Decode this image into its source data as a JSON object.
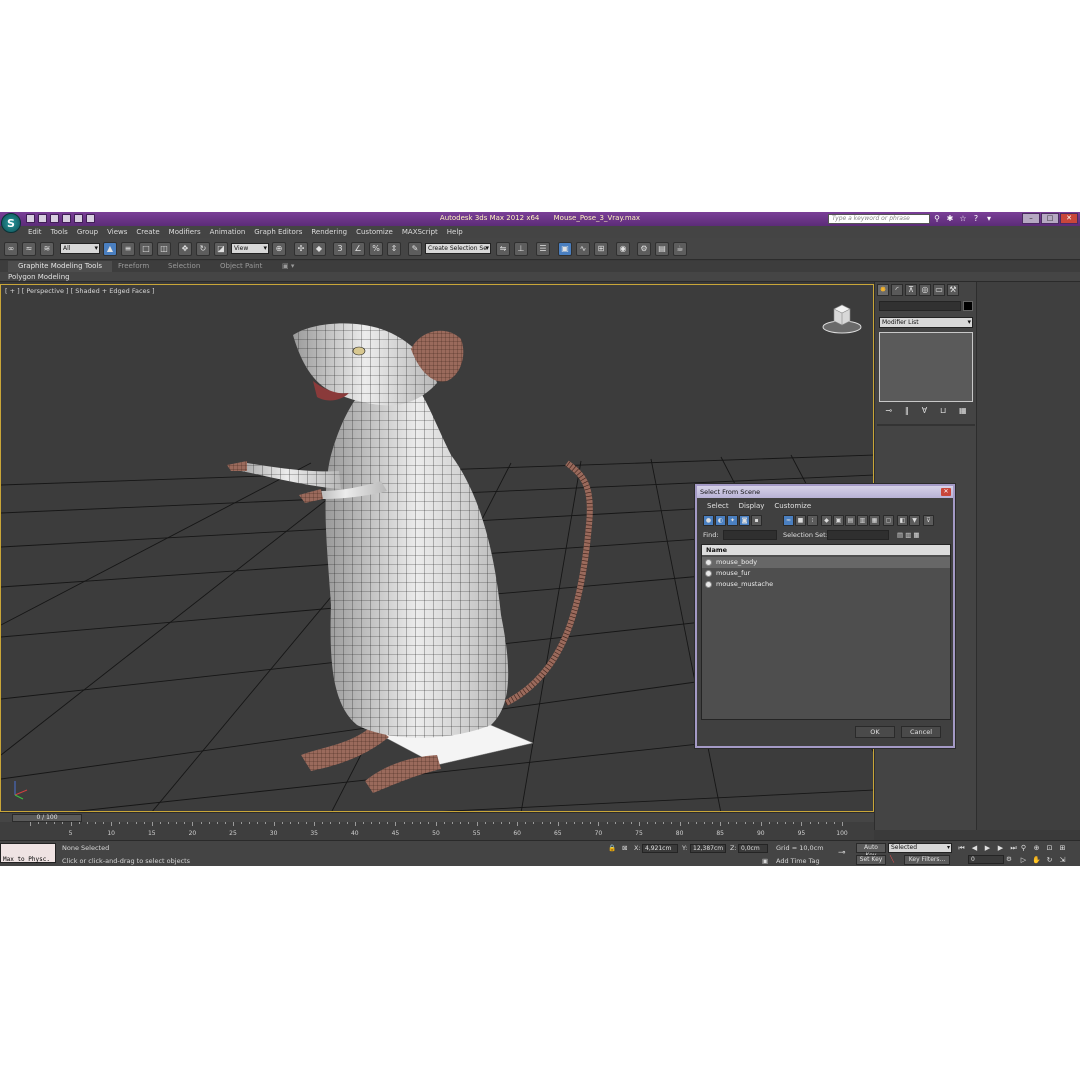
{
  "titlebar": {
    "app_name": "Autodesk 3ds Max  2012 x64",
    "file_name": "Mouse_Pose_3_Vray.max",
    "search_placeholder": "Type a keyword or phrase",
    "accent": "#6d3a8a"
  },
  "menu": [
    "Edit",
    "Tools",
    "Group",
    "Views",
    "Create",
    "Modifiers",
    "Animation",
    "Graph Editors",
    "Rendering",
    "Customize",
    "MAXScript",
    "Help"
  ],
  "toolbar": {
    "filter_select": "All",
    "coord_system": "View",
    "selection_set_placeholder": "Create Selection Se"
  },
  "ribbon": {
    "tabs": [
      "Graphite Modeling Tools",
      "Freeform",
      "Selection",
      "Object Paint"
    ],
    "active_tab": "Graphite Modeling Tools",
    "sub_label": "Polygon Modeling"
  },
  "viewport": {
    "label": "[ + ] [ Perspective ] [ Shaded + Edged Faces ]",
    "frame_color": "#c9a638"
  },
  "command_panel": {
    "modifier_list": "Modifier List"
  },
  "dialog": {
    "title": "Select From Scene",
    "menu": [
      "Select",
      "Display",
      "Customize"
    ],
    "find_label": "Find:",
    "selection_set_label": "Selection Set:",
    "column_header": "Name",
    "items": [
      {
        "name": "mouse_body",
        "selected": true
      },
      {
        "name": "mouse_fur",
        "selected": false
      },
      {
        "name": "mouse_mustache",
        "selected": false
      }
    ],
    "ok_label": "OK",
    "cancel_label": "Cancel"
  },
  "timeline": {
    "slider_label": "0 / 100",
    "ticks": [
      0,
      5,
      10,
      15,
      20,
      25,
      30,
      35,
      40,
      45,
      50,
      55,
      60,
      65,
      70,
      75,
      80,
      85,
      90,
      95,
      100
    ]
  },
  "status": {
    "maxscript_text": "Max to Physc.",
    "selection_state": "None Selected",
    "prompt": "Click or click-and-drag to select objects",
    "x_label": "X:",
    "x_value": "4,921cm",
    "y_label": "Y:",
    "y_value": "12,387cm",
    "z_label": "Z:",
    "z_value": "0,0cm",
    "grid": "Grid = 10,0cm",
    "add_time_tag": "Add Time Tag",
    "auto_key": "Auto Key",
    "set_key": "Set Key",
    "key_mode": "Selected",
    "key_filters": "Key Filters...",
    "frame_value": "0"
  }
}
